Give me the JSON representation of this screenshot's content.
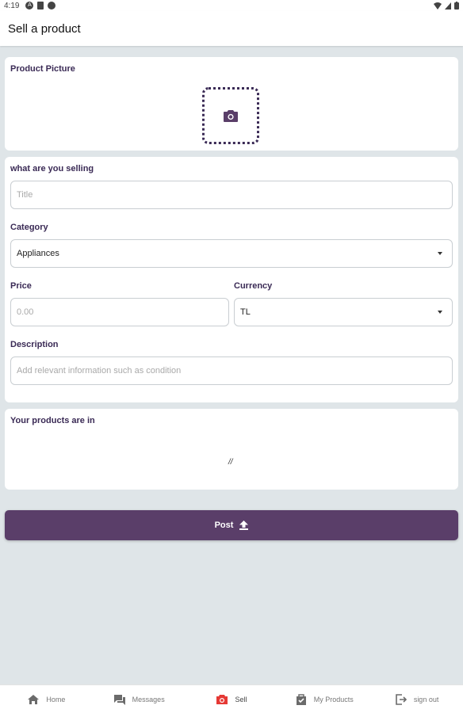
{
  "status_bar": {
    "time": "4:19"
  },
  "app_bar": {
    "title": "Sell a product"
  },
  "photo": {
    "label": "Product Picture"
  },
  "form": {
    "title_label": "what are you selling",
    "title_placeholder": "Title",
    "category_label": "Category",
    "category_value": "Appliances",
    "price_label": "Price",
    "price_placeholder": "0.00",
    "currency_label": "Currency",
    "currency_value": "TL",
    "description_label": "Description",
    "description_placeholder": "Add relevant information such as condition"
  },
  "products": {
    "label": "Your products are in",
    "empty_text": "//"
  },
  "post_button": {
    "label": "Post"
  },
  "bottom_nav": {
    "items": [
      {
        "label": "Home",
        "icon": "home-icon"
      },
      {
        "label": "Messages",
        "icon": "messages-icon"
      },
      {
        "label": "Sell",
        "icon": "camera-icon",
        "active": true
      },
      {
        "label": "My Products",
        "icon": "bag-check-icon"
      },
      {
        "label": "sign out",
        "icon": "sign-out-icon"
      }
    ]
  },
  "colors": {
    "accent": "#5a3e69",
    "label_text": "#3a2a55",
    "background": "#dfe5e8",
    "sell_active": "#e53935"
  }
}
